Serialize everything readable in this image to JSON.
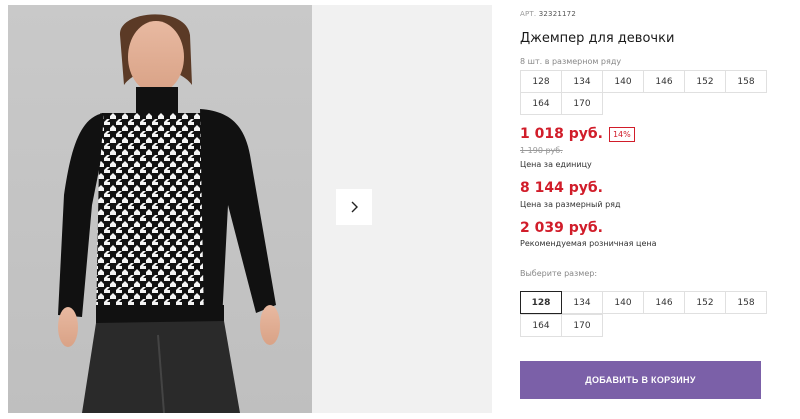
{
  "gallery": {
    "photo_alt": "Джемпер для девочки",
    "next_icon": "chevron-right-icon"
  },
  "product": {
    "sku_prefix": "АРТ.",
    "sku_value": "32321172",
    "title": "Джемпер для девочки",
    "range_label": "8 шт. в размерном ряду",
    "range_sizes": [
      "128",
      "134",
      "140",
      "146",
      "152",
      "158",
      "164",
      "170"
    ]
  },
  "prices": {
    "unit_price": "1 018 руб.",
    "discount": "14%",
    "old_price": "1 190 руб.",
    "unit_note": "Цена за единицу",
    "pack_price": "8 144 руб.",
    "pack_note": "Цена за размерный ряд",
    "retail_price": "2 039 руб.",
    "retail_note": "Рекомендуемая розничная цена"
  },
  "size_picker": {
    "label": "Выберите размер:",
    "sizes": [
      "128",
      "134",
      "140",
      "146",
      "152",
      "158",
      "164",
      "170"
    ],
    "selected": "128"
  },
  "cart": {
    "button_label": "ДОБАВИТЬ В КОРЗИНУ"
  },
  "colors": {
    "price_red": "#d11d2a",
    "cart_purple": "#7b60a8"
  }
}
